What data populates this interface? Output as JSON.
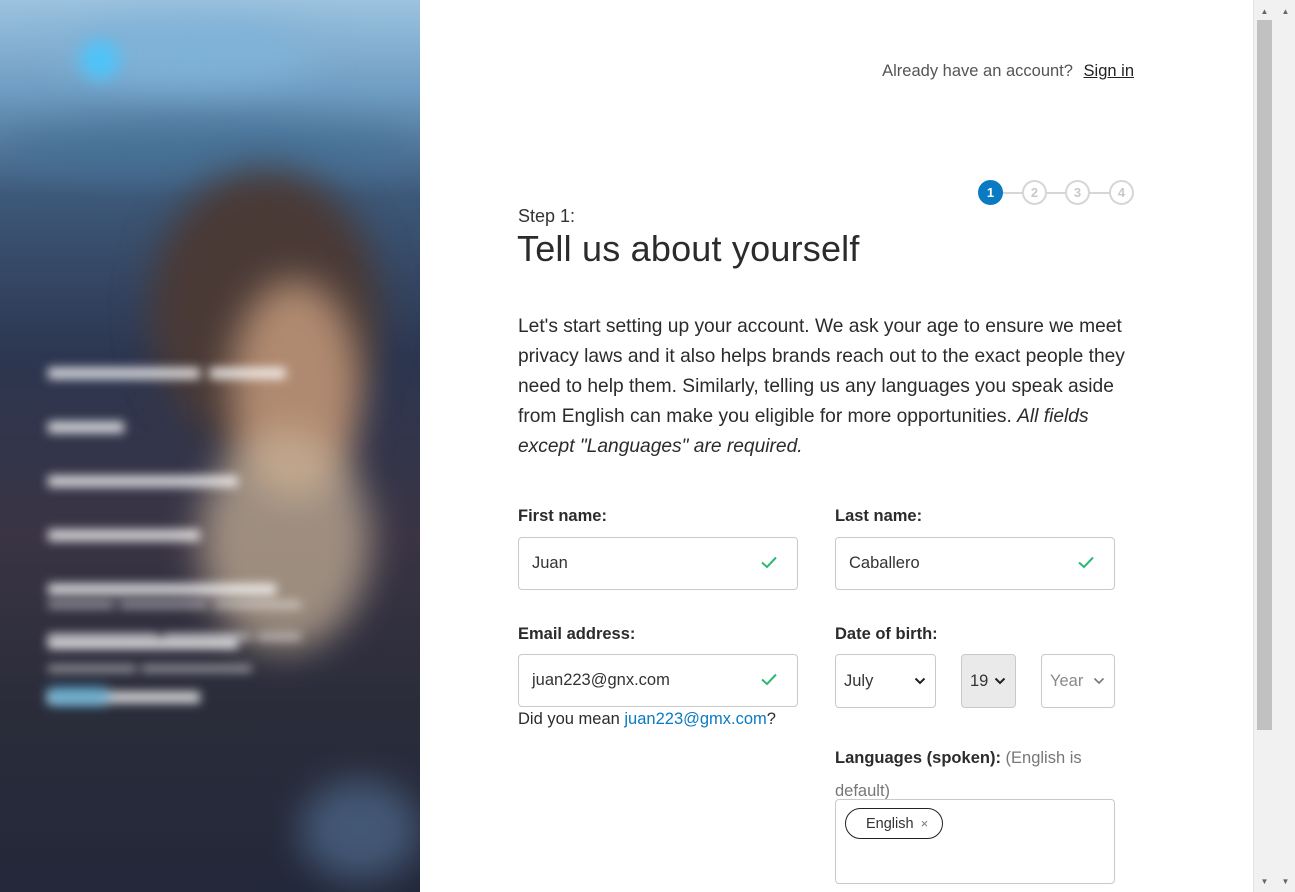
{
  "header": {
    "already_text": "Already have an account?",
    "signin_label": "Sign in"
  },
  "stepper": {
    "steps": [
      "1",
      "2",
      "3",
      "4"
    ],
    "current": 1,
    "active_color": "#0a7ac2"
  },
  "step": {
    "label": "Step 1:",
    "title": "Tell us about yourself"
  },
  "intro": {
    "text": "Let's start setting up your account. We ask your age to ensure we meet privacy laws and it also helps brands reach out to the exact people they need to help them. Similarly, telling us any languages you speak aside from English can make you eligible for more opportunities. ",
    "emphasis": "All fields except \"Languages\" are required."
  },
  "form": {
    "first_name": {
      "label": "First name:",
      "value": "Juan",
      "valid_icon": "check-icon"
    },
    "last_name": {
      "label": "Last name:",
      "value": "Caballero",
      "valid_icon": "check-icon"
    },
    "email": {
      "label": "Email address:",
      "value": "juan223@gnx.com",
      "valid_icon": "check-icon"
    },
    "email_suggestion": {
      "prefix": "Did you mean ",
      "suggestion": "juan223@gmx.com",
      "suffix": "?"
    },
    "dob": {
      "label": "Date of birth:",
      "month": "July",
      "day": "19",
      "year_placeholder": "Year"
    },
    "languages": {
      "label": "Languages (spoken):",
      "hint": "(English is default)",
      "chips": [
        "English"
      ],
      "remove_glyph": "×"
    }
  },
  "colors": {
    "check": "#2eb872",
    "link": "#0a7ac2"
  }
}
